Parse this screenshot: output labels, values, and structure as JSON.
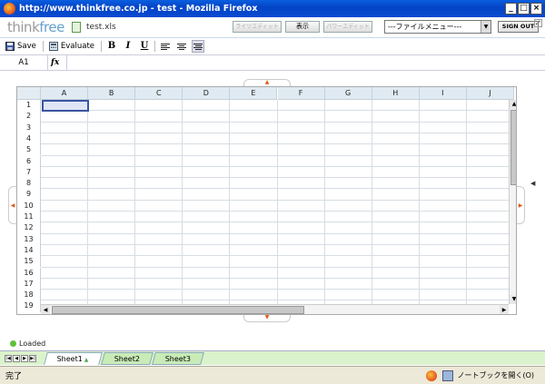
{
  "window": {
    "title": "http://www.thinkfree.co.jp - test - Mozilla Firefox"
  },
  "header": {
    "logo_prefix": "think",
    "logo_suffix": "free",
    "file_name": "test.xls",
    "buttons": [
      {
        "label": "ライツエディット",
        "enabled": false
      },
      {
        "label": "表示",
        "enabled": true
      },
      {
        "label": "パワーエディット",
        "enabled": false
      }
    ],
    "menu_value": "---ファイルメニュー---",
    "signout_label": "SIGN OUT"
  },
  "toolbar": {
    "save_label": "Save",
    "evaluate_label": "Evaluate",
    "bold": "B",
    "italic": "I",
    "underline": "U"
  },
  "formula_bar": {
    "cell_ref": "A1",
    "fx_label": "fx",
    "value": ""
  },
  "sheet": {
    "columns": [
      "A",
      "B",
      "C",
      "D",
      "E",
      "F",
      "G",
      "H",
      "I",
      "J"
    ],
    "rows": [
      "1",
      "2",
      "3",
      "4",
      "5",
      "6",
      "7",
      "8",
      "9",
      "10",
      "11",
      "12",
      "13",
      "14",
      "15",
      "16",
      "17",
      "18",
      "19"
    ],
    "selected_cell": "A1"
  },
  "status": {
    "loaded_label": "Loaded"
  },
  "tabs": [
    {
      "label": "Sheet1",
      "active": true
    },
    {
      "label": "Sheet2",
      "active": false
    },
    {
      "label": "Sheet3",
      "active": false
    }
  ],
  "browser_status": {
    "text": "完了",
    "note": "ノートブックを開く(O)"
  },
  "colors": {
    "titlebar": "#0344c6",
    "tab_bar": "#dbf3cc",
    "selection": "#3a55a0"
  }
}
